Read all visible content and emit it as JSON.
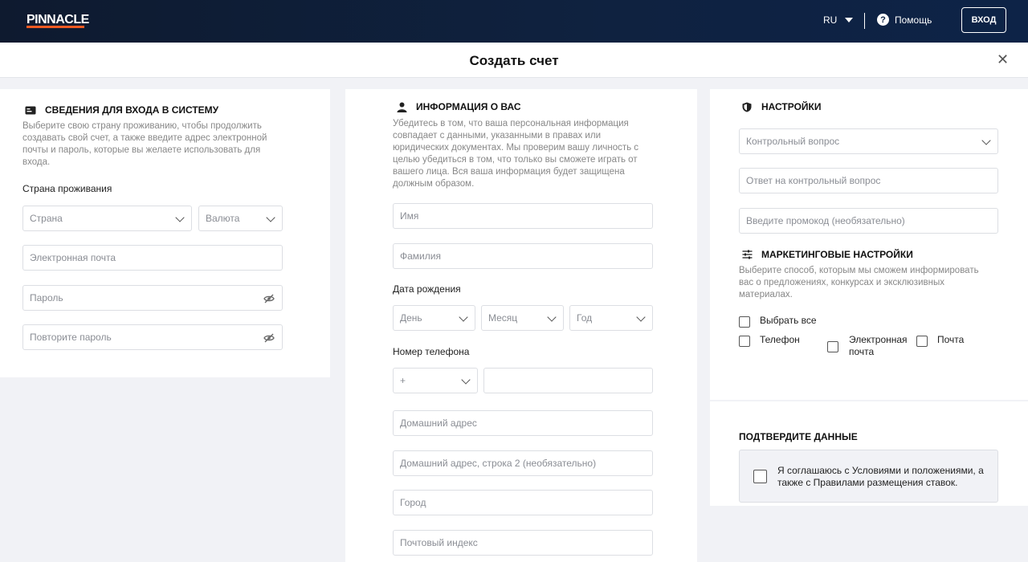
{
  "topbar": {
    "logo": "PINNACLE",
    "lang": "RU",
    "help": "Помощь",
    "login": "ВХОД"
  },
  "header": {
    "title": "Создать счет",
    "close_icon": "close-icon"
  },
  "login_section": {
    "title": "СВЕДЕНИЯ ДЛЯ ВХОДА В СИСТЕМУ",
    "desc_lines": [
      "Выберите свою страну проживанию, чтобы продолжить",
      "создавать свой счет, а также введите адрес электронной",
      "почты и пароль, которые вы желаете использовать для",
      "входа."
    ],
    "country_label": "Страна проживания",
    "country_placeholder": "Страна",
    "currency_placeholder": "Валюта",
    "email_placeholder": "Электронная почта",
    "password_placeholder": "Пароль",
    "repeat_password_placeholder": "Повторите пароль"
  },
  "about_section": {
    "title": "ИНФОРМАЦИЯ О ВАС",
    "desc_lines": [
      "Убедитесь в том, что ваша персональная информация",
      "совпадает с данными, указанными в правах или",
      "юридических документах. Мы проверим вашу личность с",
      "целью убедиться в том, что только вы сможете играть от",
      "вашего лица. Вся ваша информация будет защищена",
      "должным образом."
    ],
    "first_name_placeholder": "Имя",
    "last_name_placeholder": "Фамилия",
    "dob_label": "Дата рождения",
    "day_placeholder": "День",
    "month_placeholder": "Месяц",
    "year_placeholder": "Год",
    "phone_label": "Номер телефона",
    "phone_code": "+",
    "address_placeholder": "Домашний адрес",
    "address2_placeholder": "Домашний адрес, строка 2 (необязательно)",
    "city_placeholder": "Город",
    "postcode_placeholder": "Почтовый индекс"
  },
  "settings_section": {
    "title": "НАСТРОЙКИ",
    "security_question_placeholder": "Контрольный вопрос",
    "security_answer_placeholder": "Ответ на контрольный вопрос",
    "promo_placeholder": "Введите промокод (необязательно)"
  },
  "marketing_section": {
    "title": "МАРКЕТИНГОВЫЕ НАСТРОЙКИ",
    "desc_lines": [
      "Выберите способ, которым мы сможем информировать",
      "вас о предложениях, конкурсах и эксклюзивных",
      "материалах."
    ],
    "select_all": "Выбрать все",
    "phone": "Телефон",
    "email_line1": "Электронная",
    "email_line2": "почта",
    "post": "Почта"
  },
  "confirm_section": {
    "title": "ПОДТВЕРДИТЕ ДАННЫЕ",
    "text_line1": "Я соглашаюсь с Условиями и положениями, а",
    "text_line2": "также с Правилами размещения ставок."
  }
}
